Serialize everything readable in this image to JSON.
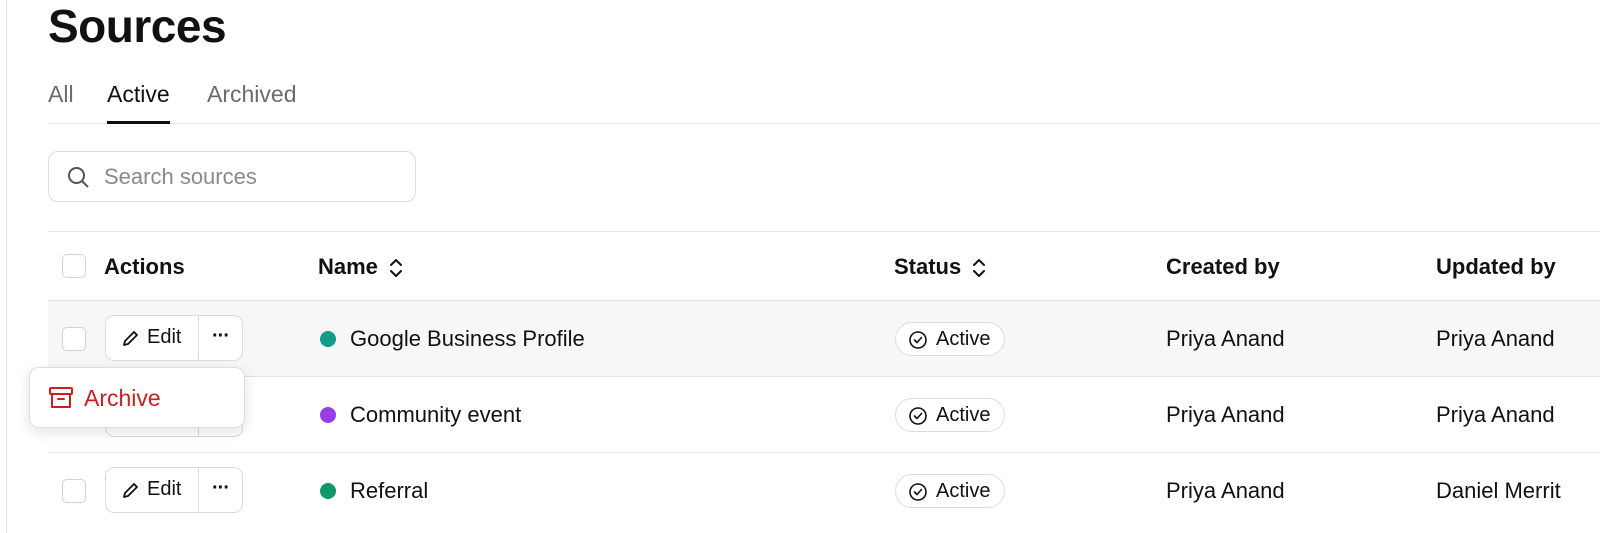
{
  "page": {
    "title": "Sources"
  },
  "tabs": [
    {
      "label": "All",
      "active": false
    },
    {
      "label": "Active",
      "active": true
    },
    {
      "label": "Archived",
      "active": false
    }
  ],
  "search": {
    "placeholder": "Search sources",
    "value": "",
    "icon": "search-icon"
  },
  "table": {
    "columns": {
      "actions": "Actions",
      "name": "Name",
      "status": "Status",
      "created_by": "Created by",
      "updated_by": "Updated by"
    },
    "edit_label": "Edit",
    "more_label": "···",
    "rows": [
      {
        "name": "Google Business Profile",
        "dot_color": "#129b86",
        "status": "Active",
        "created_by": "Priya Anand",
        "updated_by": "Priya Anand"
      },
      {
        "name": "Community event",
        "dot_color": "#9a3be8",
        "status": "Active",
        "created_by": "Priya Anand",
        "updated_by": "Priya Anand"
      },
      {
        "name": "Referral",
        "dot_color": "#139668",
        "status": "Active",
        "created_by": "Priya Anand",
        "updated_by": "Daniel Merrit"
      }
    ]
  },
  "menu": {
    "archive_label": "Archive",
    "archive_color": "#cc1f1f",
    "icon": "archive-icon"
  }
}
